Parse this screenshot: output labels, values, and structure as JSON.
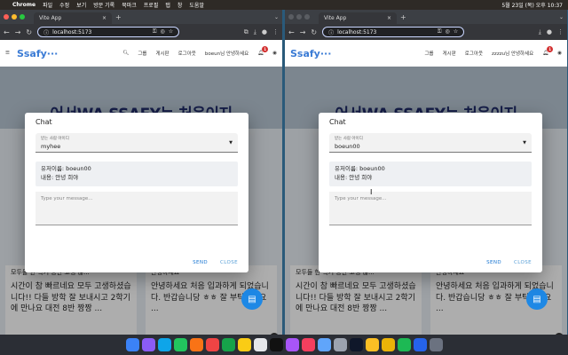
{
  "menubar": {
    "app": "Chrome",
    "items": [
      "파일",
      "수정",
      "보기",
      "방문 기록",
      "북마크",
      "프로필",
      "탭",
      "창",
      "도움말"
    ],
    "clock": "5월 23일 (목) 오후 10:37"
  },
  "browser": {
    "tab_title": "Vite App",
    "url": "localhost:5173"
  },
  "app": {
    "logo": "Ssafy···",
    "nav": [
      "그룹",
      "게시판",
      "로그아웃"
    ],
    "greeting_left": "boeun님 안녕하세요",
    "greeting_right": "zzzzu님 안녕하세요",
    "notification_count": "1",
    "hero_title": "어서WA SSAFY는 처음이지"
  },
  "cards": [
    {
      "heading": "모두들 한 학기 동안 고생 많...",
      "body": "시간이 참 빠르네요 모두 고생하셨습니다!! 다들 방학 잘 보내시고 2학기에 만나요 대전 8반 짱짱 ..."
    },
    {
      "heading": "안녕하세요",
      "body": "안녕하세요 처음 입과하게 되었습니다. 반갑습니당 ㅎㅎ 잘 부탁드려요 ..."
    }
  ],
  "dialog_left": {
    "title": "Chat",
    "select_label": "받는 사람 아이디",
    "select_value": "myhee",
    "message_user": "유저이름: boeun00",
    "message_content": "내용: 안녕 희야",
    "input_placeholder": "Type your message...",
    "send": "SEND",
    "close": "CLOSE"
  },
  "dialog_right": {
    "title": "Chat",
    "select_label": "받는 사람 아이디",
    "select_value": "boeun00",
    "message_user": "유저이름: boeun00",
    "message_content": "내용: 안녕 희야",
    "input_placeholder": "Type your message...",
    "send": "SEND",
    "close": "CLOSE"
  },
  "colors": {
    "accent": "#1976d2",
    "logo": "#3a7bd5",
    "hero_text": "#1f2b6b"
  }
}
